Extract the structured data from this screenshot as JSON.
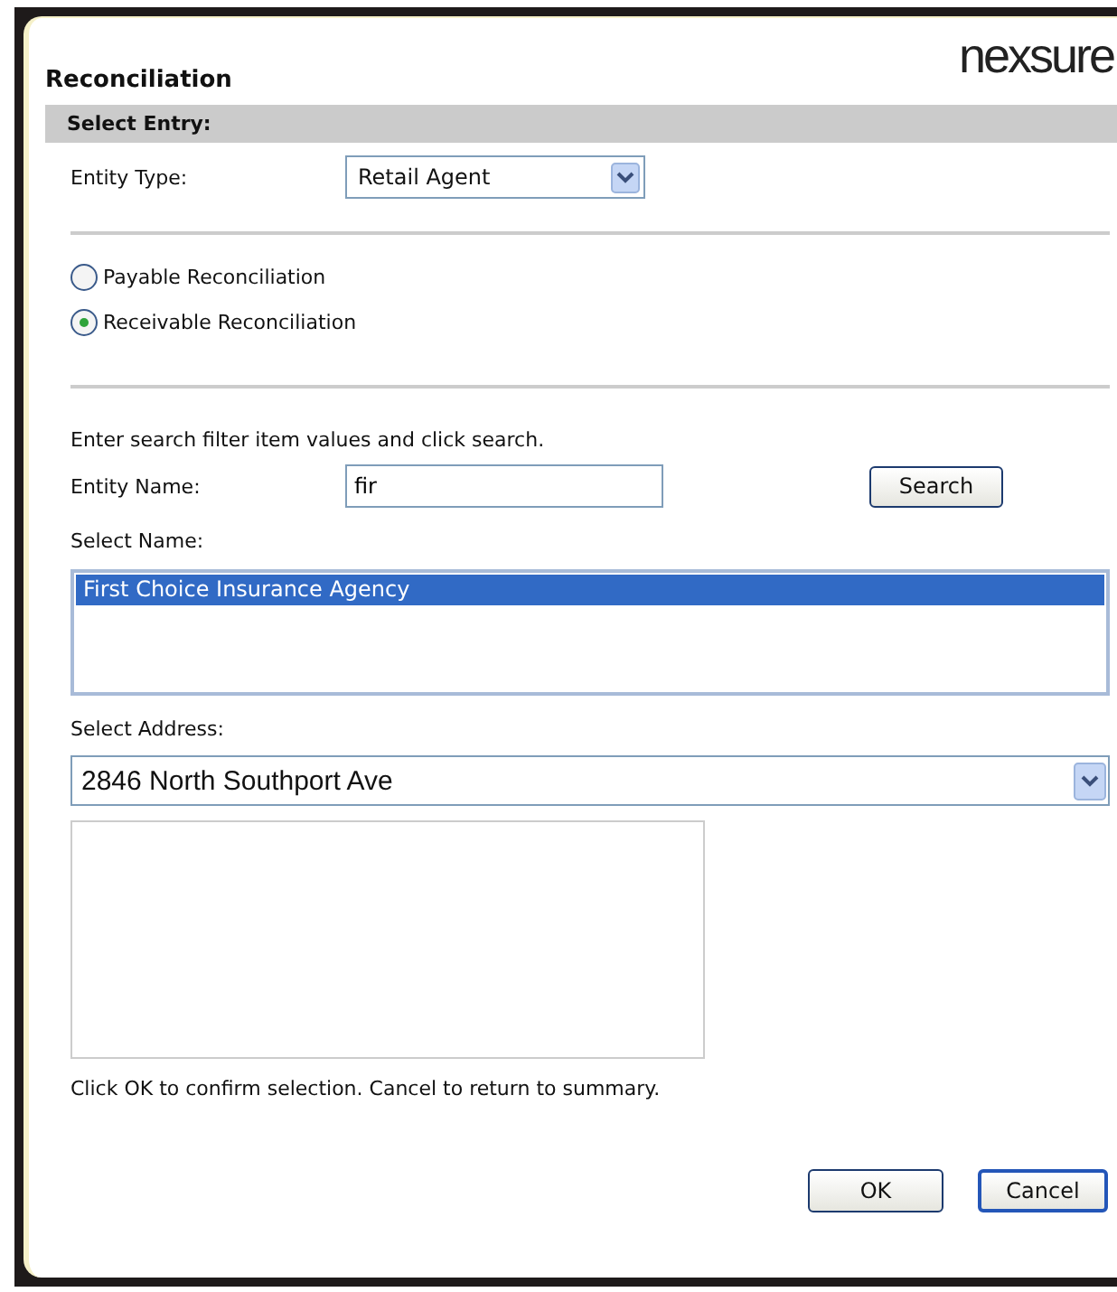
{
  "dialog": {
    "title": "Reconciliation",
    "logo": "nexsure"
  },
  "section_header": "Select Entry:",
  "entity_type": {
    "label": "Entity Type:",
    "value": "Retail Agent"
  },
  "reconciliation_options": [
    {
      "label": "Payable Reconciliation",
      "selected": false
    },
    {
      "label": "Receivable Reconciliation",
      "selected": true
    }
  ],
  "search_hint": "Enter search filter item values and click search.",
  "entity_name": {
    "label": "Entity Name:",
    "value": "fir"
  },
  "search_button": "Search",
  "select_name": {
    "label": "Select Name:",
    "items": [
      {
        "text": "First Choice Insurance Agency",
        "selected": true
      }
    ]
  },
  "select_address": {
    "label": "Select Address:",
    "value": "2846 North Southport Ave"
  },
  "confirm_hint": "Click OK to confirm selection. Cancel to return to summary.",
  "buttons": [
    {
      "label": "OK",
      "default": false
    },
    {
      "label": "Cancel",
      "default": true
    }
  ]
}
